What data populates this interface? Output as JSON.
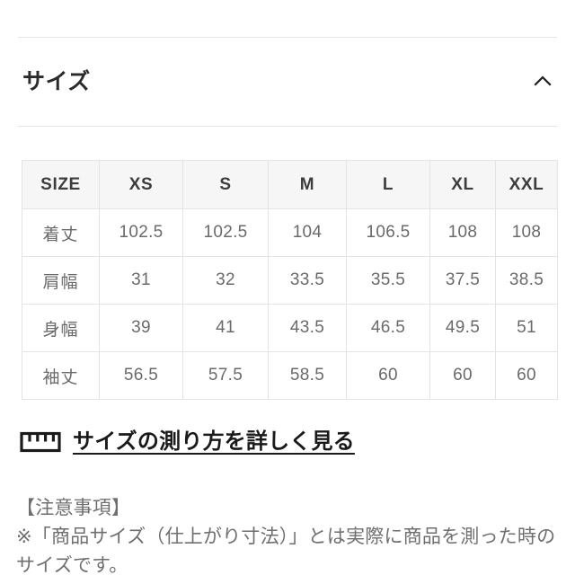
{
  "section": {
    "title": "サイズ",
    "collapse_icon": "chevron-up-icon"
  },
  "size_table": {
    "columns": [
      "SIZE",
      "XS",
      "S",
      "M",
      "L",
      "XL",
      "XXL"
    ],
    "rows": [
      {
        "label": "着丈",
        "values": [
          "102.5",
          "102.5",
          "104",
          "106.5",
          "108",
          "108"
        ]
      },
      {
        "label": "肩幅",
        "values": [
          "31",
          "32",
          "33.5",
          "35.5",
          "37.5",
          "38.5"
        ]
      },
      {
        "label": "身幅",
        "values": [
          "39",
          "41",
          "43.5",
          "46.5",
          "49.5",
          "51"
        ]
      },
      {
        "label": "袖丈",
        "values": [
          "56.5",
          "57.5",
          "58.5",
          "60",
          "60",
          "60"
        ]
      }
    ]
  },
  "measure_link": {
    "icon": "ruler-icon",
    "label": "サイズの測り方を詳しく見る"
  },
  "notes": {
    "heading": "【注意事項】",
    "line1": "※「商品サイズ（仕上がり寸法）」とは実際に商品を測った時の",
    "line2": "サイズです。"
  },
  "colors": {
    "text_dark": "#2b2b2b",
    "text_gray": "#6a6a6a",
    "note_gray": "#6f6f6f",
    "border": "#e4e4e4",
    "header_bg": "#f6f6f6",
    "background": "#ffffff"
  }
}
